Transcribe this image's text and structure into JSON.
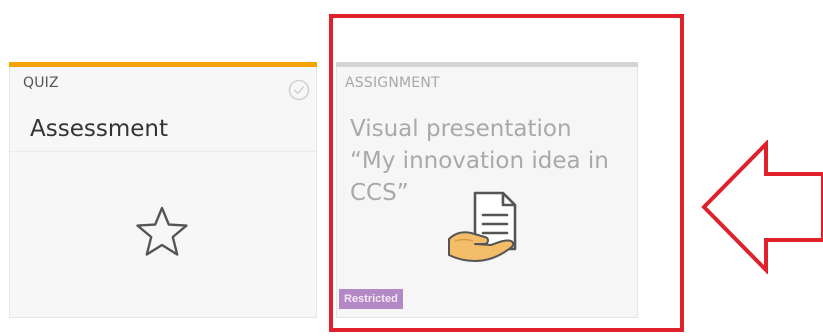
{
  "quiz_card": {
    "type_label": "QUIZ",
    "title": "Assessment",
    "accent_color": "#f5a300",
    "icons": [
      "check-circle-icon",
      "star-outline-icon"
    ]
  },
  "assignment_card": {
    "type_label": "ASSIGNMENT",
    "title": "Visual presentation “My innovation idea in CCS”",
    "accent_color": "#d4d4d4",
    "badge": "Restricted",
    "badge_color": "#b488c4",
    "icons": [
      "hand-document-icon"
    ]
  },
  "annotation": {
    "highlight_color": "#e0202a",
    "icons": [
      "left-arrow-icon"
    ]
  }
}
